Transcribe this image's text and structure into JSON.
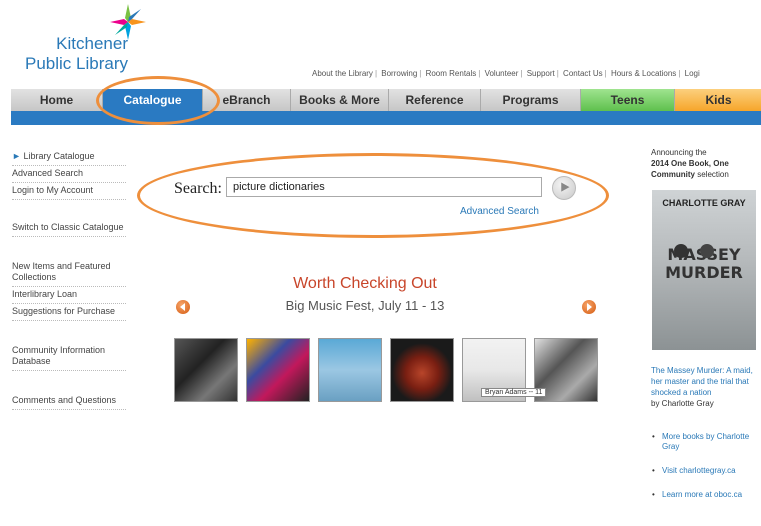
{
  "logo": {
    "line1": "Kitchener",
    "line2": "Public Library"
  },
  "utility_links": [
    "About the Library",
    "Borrowing",
    "Room Rentals",
    "Volunteer",
    "Support",
    "Contact Us",
    "Hours & Locations",
    "Logi"
  ],
  "nav": [
    {
      "label": "Home",
      "bg": "#d6d6d6"
    },
    {
      "label": "Catalogue",
      "bg": "#2a7ac2",
      "color": "#ffffff"
    },
    {
      "label": "eBranch",
      "bg": "#d6d6d6"
    },
    {
      "label": "Books & More",
      "bg": "#d6d6d6"
    },
    {
      "label": "Reference",
      "bg": "#d6d6d6"
    },
    {
      "label": "Programs",
      "bg": "#d6d6d6"
    },
    {
      "label": "Teens",
      "bg": "#79d36b"
    },
    {
      "label": "Kids",
      "bg": "#f9b64a"
    }
  ],
  "sidebar": {
    "items": [
      "Library Catalogue",
      "Advanced Search",
      "Login to My Account",
      "Switch to Classic Catalogue",
      "New Items and Featured Collections",
      "Interlibrary Loan",
      "Suggestions for Purchase",
      "Community Information Database",
      "Comments and Questions"
    ]
  },
  "search": {
    "label": "Search:",
    "value": "picture dictionaries",
    "advanced": "Advanced Search"
  },
  "carousel": {
    "title": "Worth Checking Out",
    "subtitle": "Big Music Fest, July 11 - 13",
    "tooltip": "Bryan Adams -- 11"
  },
  "promo": {
    "announce_1": "Announcing the",
    "announce_2": "2014 One Book, One",
    "announce_3": "Community",
    "announce_4": "selection",
    "book_author": "CHARLOTTE GRAY",
    "book_title_1": "MASSEY",
    "book_title_2": "MURDER",
    "desc_title": "The Massey Murder: A maid, her master and the trial that shocked a nation",
    "desc_by": "by Charlotte Gray",
    "links": [
      "More books by Charlotte Gray",
      "Visit charlottegray.ca",
      "Learn more at oboc.ca"
    ]
  },
  "colors": {
    "accent": "#2a7ac2",
    "annotation": "#ee8f3c",
    "highlight": "#c8452a"
  },
  "icons": {
    "search_go": "play-arrow-icon",
    "carousel_prev": "arrow-left-icon",
    "carousel_next": "arrow-right-icon",
    "logo": "pinwheel-star-icon"
  }
}
